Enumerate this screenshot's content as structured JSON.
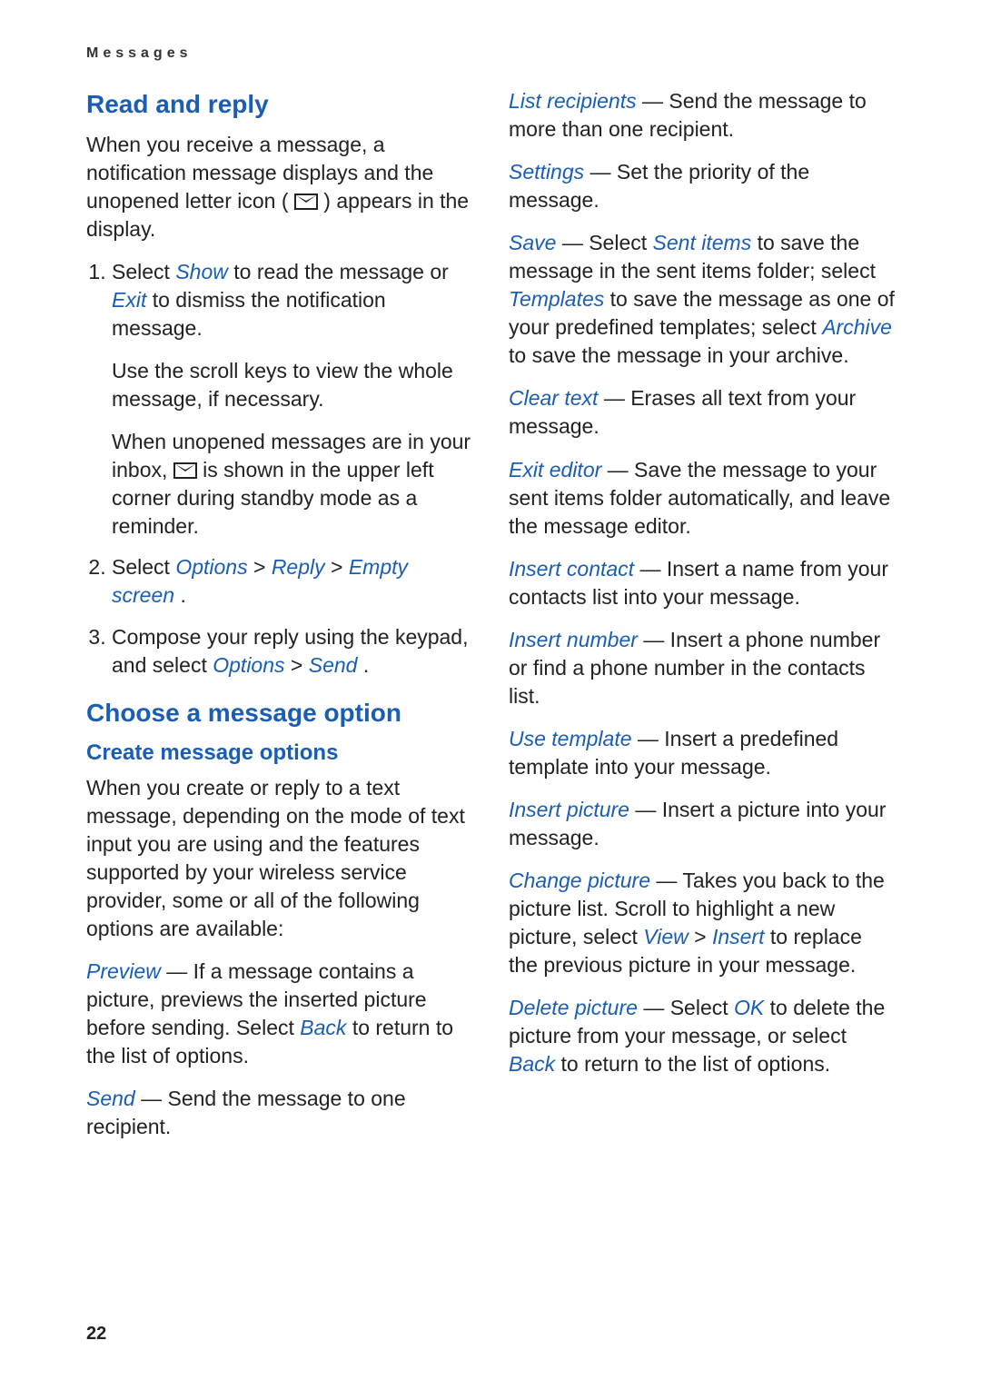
{
  "header": "Messages",
  "page_number": "22",
  "left": {
    "h_read_reply": "Read and reply",
    "p_intro_a": "When you receive a message, a notification message displays and the unopened letter icon (",
    "p_intro_b": ") appears in the display.",
    "li1_a": "Select ",
    "li1_show": "Show",
    "li1_b": " to read the message or ",
    "li1_exit": "Exit",
    "li1_c": " to dismiss the notification message.",
    "li1_sub1": "Use the scroll keys to view the whole message, if necessary.",
    "li1_sub2_a": "When unopened messages are in your inbox, ",
    "li1_sub2_b": " is shown in the upper left corner during standby mode as a reminder.",
    "li2_a": "Select ",
    "li2_options": "Options",
    "li2_gt1": " > ",
    "li2_reply": "Reply",
    "li2_gt2": " > ",
    "li2_empty": "Empty screen",
    "li2_end": ".",
    "li3_a": "Compose your reply using the keypad, and select ",
    "li3_options": "Options",
    "li3_gt": " > ",
    "li3_send": "Send",
    "li3_end": ".",
    "h_choose": "Choose a message option",
    "h_create": "Create message options",
    "p_create": "When you create or reply to a text message, depending on the mode of text input you are using and the features supported by your wireless service provider, some or all of the following options are available:",
    "opt_preview": "Preview",
    "opt_preview_a": " — If a message contains a picture, previews the inserted picture before sending. Select ",
    "opt_preview_back": "Back",
    "opt_preview_b": " to return to the list of options.",
    "opt_send": "Send",
    "opt_send_a": " — Send the message to one recipient."
  },
  "right": {
    "opt_list": "List recipients",
    "opt_list_a": " — Send the message to more than one recipient.",
    "opt_settings": "Settings",
    "opt_settings_a": " — Set the priority of the message.",
    "opt_save": "Save",
    "opt_save_a": " — Select ",
    "opt_save_sent": "Sent items",
    "opt_save_b": " to save the message in the sent items folder; select ",
    "opt_save_templates": "Templates",
    "opt_save_c": " to save the message as one of your predefined templates; select ",
    "opt_save_archive": "Archive",
    "opt_save_d": " to save the message in your archive.",
    "opt_clear": "Clear text",
    "opt_clear_a": " — Erases all text from your message.",
    "opt_exit": "Exit editor",
    "opt_exit_a": " — Save the message to your sent items folder automatically, and leave the message editor.",
    "opt_insc": "Insert contact",
    "opt_insc_a": " — Insert a name from your contacts list into your message.",
    "opt_insn": "Insert number",
    "opt_insn_a": " — Insert a phone number or find a phone number in the contacts list.",
    "opt_usetpl": "Use template",
    "opt_usetpl_a": " — Insert a predefined template into your message.",
    "opt_inspic": "Insert picture",
    "opt_inspic_a": " — Insert a picture into your message.",
    "opt_chpic": "Change picture",
    "opt_chpic_a": " — Takes you back to the picture list. Scroll to highlight a new picture, select ",
    "opt_chpic_view": "View",
    "opt_chpic_gt": " > ",
    "opt_chpic_insert": "Insert",
    "opt_chpic_b": " to replace the previous picture in your message.",
    "opt_delpic": "Delete picture",
    "opt_delpic_a": " — Select ",
    "opt_delpic_ok": "OK",
    "opt_delpic_b": " to delete the picture from your message, or select ",
    "opt_delpic_back": "Back",
    "opt_delpic_c": " to return to the list of options."
  }
}
